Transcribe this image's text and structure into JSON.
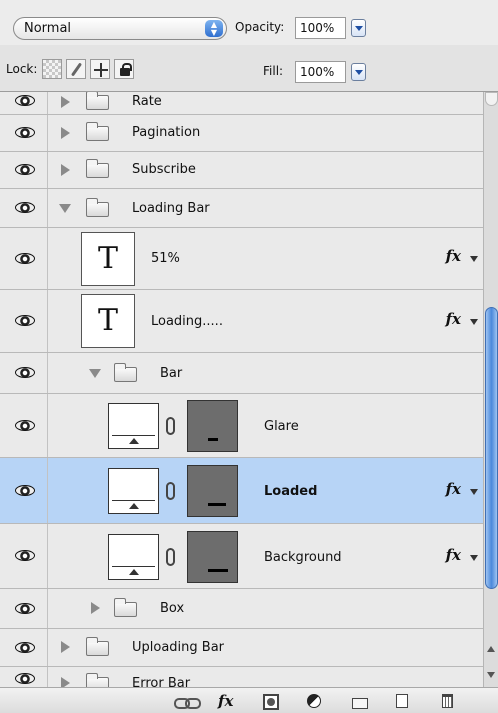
{
  "options": {
    "blend_mode": "Normal",
    "opacity_label": "Opacity:",
    "opacity_value": "100%",
    "lock_label": "Lock:",
    "fill_label": "Fill:",
    "fill_value": "100%"
  },
  "layers": [
    {
      "name": "Rate",
      "kind": "group",
      "expanded": false,
      "level": 0,
      "selected": false
    },
    {
      "name": "Pagination",
      "kind": "group",
      "expanded": false,
      "level": 0,
      "selected": false
    },
    {
      "name": "Subscribe",
      "kind": "group",
      "expanded": false,
      "level": 0,
      "selected": false
    },
    {
      "name": "Loading Bar",
      "kind": "group",
      "expanded": true,
      "level": 0,
      "selected": false
    },
    {
      "name": "51%",
      "kind": "text",
      "thumb_glyph": "T",
      "has_fx": true,
      "fx_label": "fx",
      "selected": false
    },
    {
      "name": "Loading.....",
      "kind": "text",
      "thumb_glyph": "T",
      "has_fx": true,
      "fx_label": "fx",
      "selected": false
    },
    {
      "name": "Bar",
      "kind": "group",
      "expanded": true,
      "level": 1,
      "selected": false
    },
    {
      "name": "Glare",
      "kind": "masked",
      "has_fx": false,
      "selected": false,
      "mask_fill": 0.2
    },
    {
      "name": "Loaded",
      "kind": "masked",
      "has_fx": true,
      "fx_label": "fx",
      "selected": true,
      "mask_fill": 0.35
    },
    {
      "name": "Background",
      "kind": "masked",
      "has_fx": true,
      "fx_label": "fx",
      "selected": false,
      "mask_fill": 0.4
    },
    {
      "name": "Box",
      "kind": "group",
      "expanded": false,
      "level": 1,
      "selected": false
    },
    {
      "name": "Uploading Bar",
      "kind": "group",
      "expanded": false,
      "level": 0,
      "selected": false
    },
    {
      "name": "Error Bar",
      "kind": "group",
      "expanded": false,
      "level": 0,
      "selected": false
    }
  ],
  "bottom_toolbar": {
    "fx_label": "fx",
    "icons": [
      "link-layers-icon",
      "fx-icon",
      "add-mask-icon",
      "adjustment-layer-icon",
      "new-group-icon",
      "new-layer-icon",
      "trash-icon"
    ]
  },
  "colors": {
    "selected_row": "#b7d4f6",
    "scroll_thumb": "#4a88db"
  }
}
